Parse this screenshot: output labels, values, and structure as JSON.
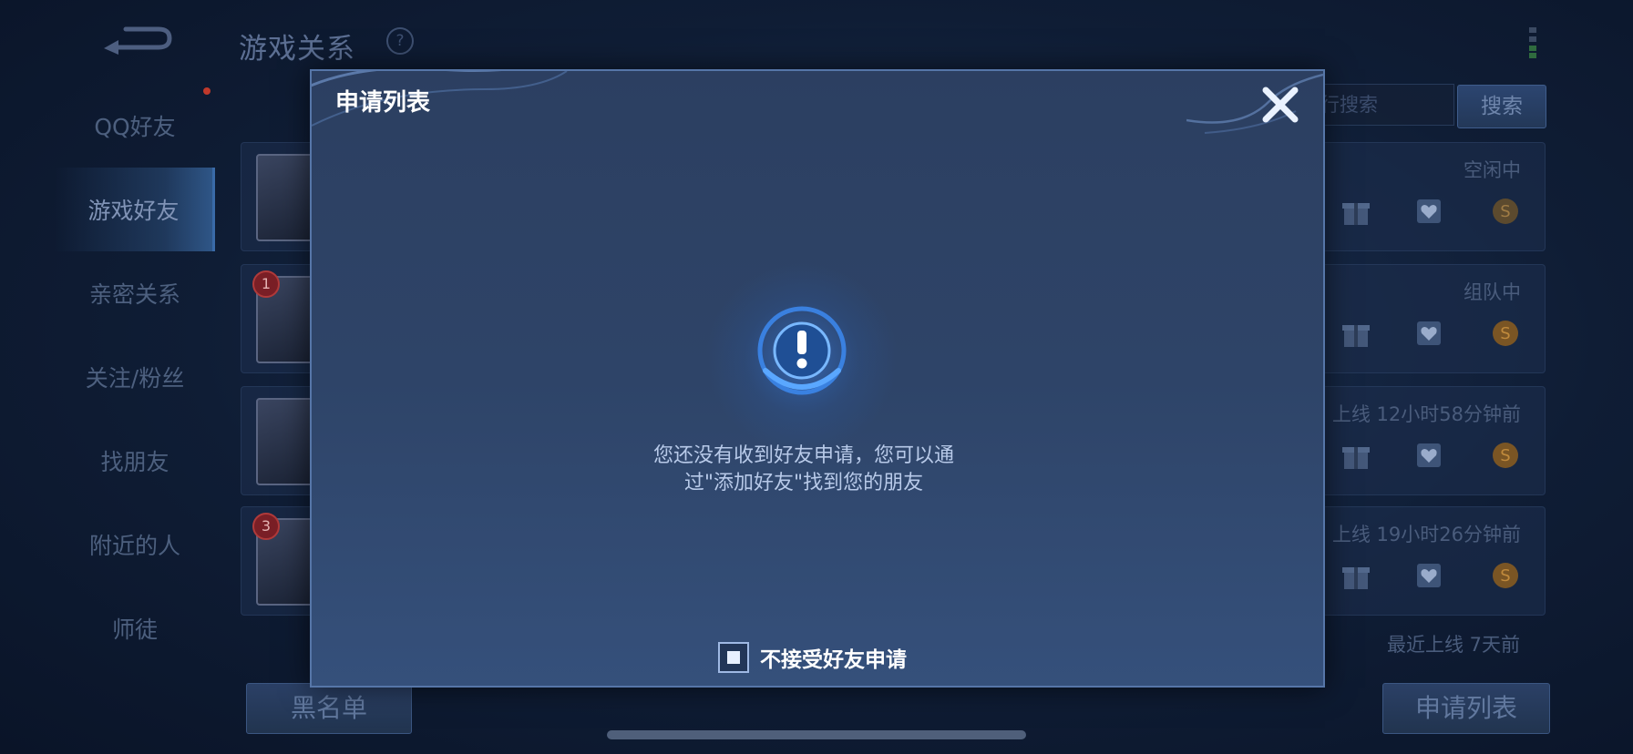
{
  "background": {
    "title": "游戏关系",
    "help_glyph": "?",
    "sidebar": [
      {
        "label": "QQ好友",
        "active": false
      },
      {
        "label": "游戏好友",
        "active": true
      },
      {
        "label": "亲密关系",
        "active": false
      },
      {
        "label": "关注/粉丝",
        "active": false
      },
      {
        "label": "找朋友",
        "active": false
      },
      {
        "label": "附近的人",
        "active": false
      },
      {
        "label": "师徒",
        "active": false
      }
    ],
    "search_placeholder": "行搜索",
    "search_button": "搜索",
    "rows": [
      {
        "status": "空闲中",
        "badge": ""
      },
      {
        "status": "组队中",
        "badge": "1"
      },
      {
        "status": "上线 12小时58分钟前",
        "badge": ""
      },
      {
        "status": "上线 19小时26分钟前",
        "badge": "3"
      },
      {
        "status": "最近上线 7天前",
        "badge": ""
      }
    ],
    "blacklist_button": "黑名单",
    "request_list_button": "申请列表"
  },
  "modal": {
    "title": "申请列表",
    "close_icon": "close-icon",
    "empty_icon": "exclamation-icon",
    "empty_line1": "您还没有收到好友申请，您可以通",
    "empty_line2": "过\"添加好友\"找到您的朋友",
    "checkbox_checked": true,
    "checkbox_label": "不接受好友申请"
  },
  "colors": {
    "modal_bg": "#2e4468",
    "modal_border": "#5676a8",
    "accent_glow": "#3f8cff",
    "text_light": "#b8cae9"
  }
}
